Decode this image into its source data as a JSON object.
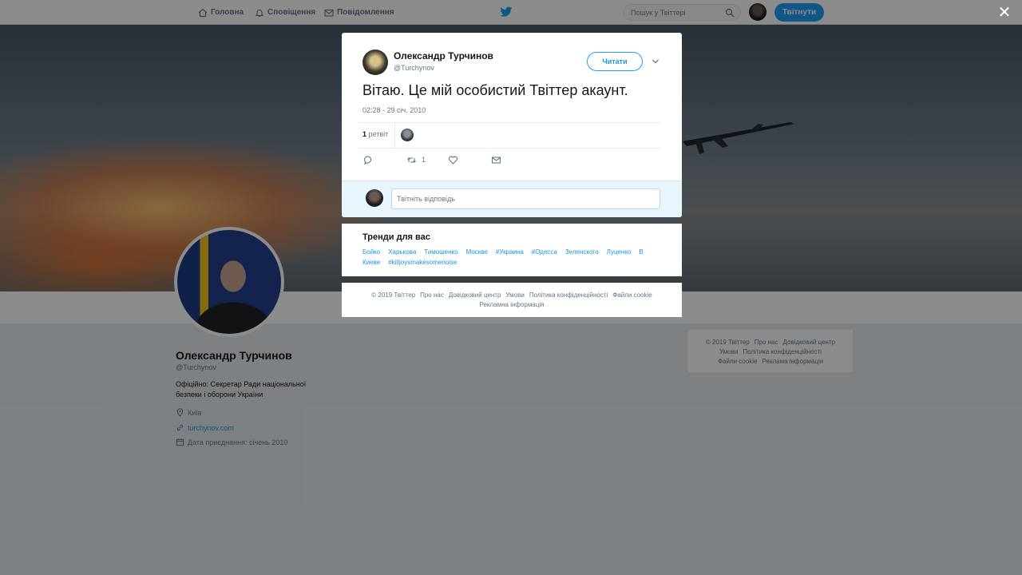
{
  "topbar": {
    "home": "Головна",
    "notifications": "Сповіщення",
    "messages": "Повідомлення",
    "search_placeholder": "Пошук у Твіттері",
    "tweet_button": "Твітнути"
  },
  "profile": {
    "name": "Олександр Турчинов",
    "handle": "@Turchynov",
    "bio": "Офіційно: Секретар Ради національної безпеки і оборони України",
    "location": "Київ",
    "url": "turchynov.com",
    "joined": "Дата приєднання: січень 2010"
  },
  "side_footer": [
    "© 2019 Твіттер",
    "Про нас",
    "Довідковий центр",
    "Умови",
    "Політика конфіденційності",
    "Файли cookie",
    "Реклама інформація"
  ],
  "modal": {
    "name": "Олександр Турчинов",
    "handle": "@Turchynov",
    "follow_label": "Читати",
    "text": "Вітаю. Це мій особистий Твіттер акаунт.",
    "timestamp": "02:28 - 29 січ. 2010",
    "retweet_count": "1",
    "retweet_label": "ретвіт",
    "retweet_action_count": "1",
    "reply_placeholder": "Твітніть відповідь"
  },
  "trends": {
    "title": "Тренди для вас",
    "items": [
      "Бойко",
      "Харькова",
      "Тимошенко",
      "Москве",
      "#Украина",
      "#Одесса",
      "Зеленского",
      "Луценко",
      "В Киеве",
      "#killjoysmakesomenoise"
    ]
  },
  "modal_footer": [
    "© 2019 Твіттер",
    "Про нас",
    "Довідковий центр",
    "Умови",
    "Політика конфіденційності",
    "Файли cookie",
    "Рекламна інформація"
  ],
  "close_symbol": "✕",
  "colors": {
    "accent": "#1da1f2",
    "link": "#1b95e0"
  }
}
